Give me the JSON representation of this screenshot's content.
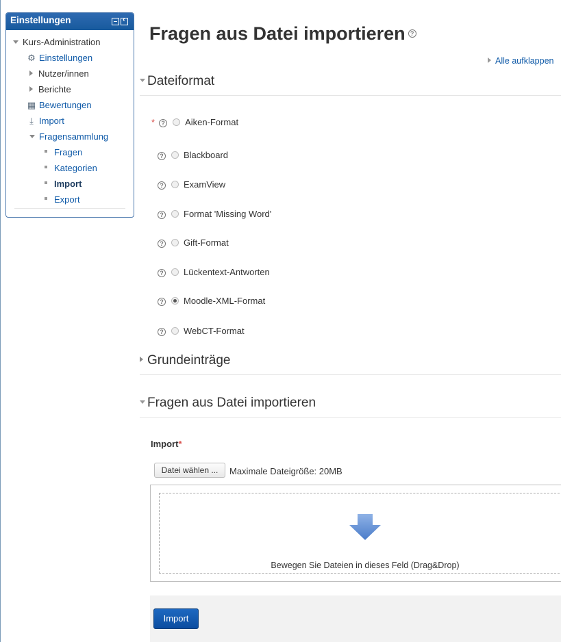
{
  "block": {
    "title": "Einstellungen",
    "tree": [
      {
        "label": "Kurs-Administration"
      },
      {
        "label": "Einstellungen",
        "icon": "gear-icon"
      },
      {
        "label": "Nutzer/innen"
      },
      {
        "label": "Berichte"
      },
      {
        "label": "Bewertungen",
        "icon": "grades-icon"
      },
      {
        "label": "Import",
        "icon": "import-icon"
      },
      {
        "label": "Fragensammlung"
      },
      {
        "label": "Fragen"
      },
      {
        "label": "Kategorien"
      },
      {
        "label": "Import",
        "current": true
      },
      {
        "label": "Export"
      }
    ]
  },
  "main": {
    "title": "Fragen aus Datei importieren",
    "expand_all": "Alle aufklappen",
    "sections": {
      "format": "Dateiformat",
      "general": "Grundeinträge",
      "import": "Fragen aus Datei importieren"
    },
    "formats": [
      {
        "label": "Aiken-Format",
        "required": "*",
        "checked": false
      },
      {
        "label": "Blackboard",
        "checked": false
      },
      {
        "label": "ExamView",
        "checked": false
      },
      {
        "label": "Format 'Missing Word'",
        "checked": false
      },
      {
        "label": "Gift-Format",
        "checked": false
      },
      {
        "label": "Lückentext-Antworten",
        "checked": false
      },
      {
        "label": "Moodle-XML-Format",
        "checked": true
      },
      {
        "label": "WebCT-Format",
        "checked": false
      }
    ],
    "file": {
      "label": "Import",
      "required": "*",
      "choose_button": "Datei wählen ...",
      "max_size": "Maximale Dateigröße: 20MB",
      "drop_hint": "Bewegen Sie Dateien in dieses Feld (Drag&Drop)"
    },
    "submit": "Import",
    "colors": {
      "accent": "#0f5aa8",
      "button": "#1d68c0",
      "required": "#d9534f"
    }
  }
}
